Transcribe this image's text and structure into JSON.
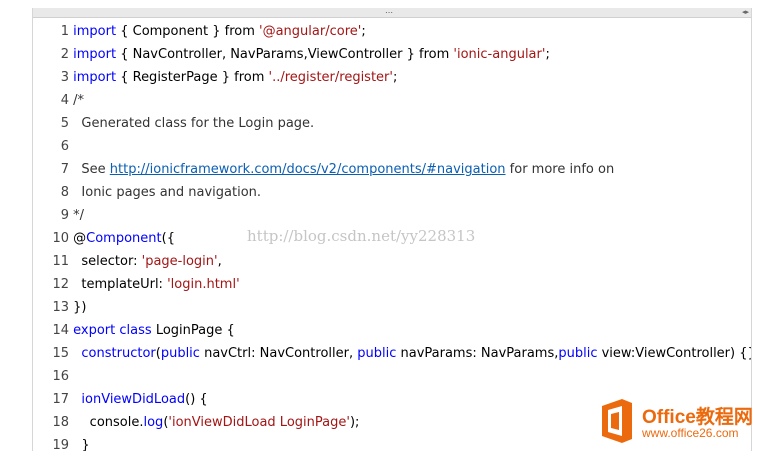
{
  "editor": {
    "grip_icon": "⋯",
    "arrows_icon": "◂▸"
  },
  "lines": [
    {
      "n": "1",
      "parts": [
        {
          "t": "import",
          "c": "kw"
        },
        {
          "t": " { Component } from ",
          "c": ""
        },
        {
          "t": "'@angular/core'",
          "c": "str"
        },
        {
          "t": ";",
          "c": ""
        }
      ]
    },
    {
      "n": "2",
      "parts": [
        {
          "t": "import",
          "c": "kw"
        },
        {
          "t": " { NavController, NavParams,ViewController } from ",
          "c": ""
        },
        {
          "t": "'ionic-angular'",
          "c": "str"
        },
        {
          "t": ";",
          "c": ""
        }
      ]
    },
    {
      "n": "3",
      "parts": [
        {
          "t": "import",
          "c": "kw"
        },
        {
          "t": " { RegisterPage } from ",
          "c": ""
        },
        {
          "t": "'../register/register'",
          "c": "str"
        },
        {
          "t": ";",
          "c": ""
        }
      ]
    },
    {
      "n": "4",
      "parts": [
        {
          "t": "/*",
          "c": "cm"
        }
      ]
    },
    {
      "n": "5",
      "parts": [
        {
          "t": "  Generated class for the Login page.",
          "c": "cm"
        }
      ]
    },
    {
      "n": "6",
      "parts": []
    },
    {
      "n": "7",
      "parts": [
        {
          "t": "  See ",
          "c": "cm"
        },
        {
          "t": "http://ionicframework.com/docs/v2/components/#navigation",
          "c": "lnk"
        },
        {
          "t": " for more info on",
          "c": "cm"
        }
      ]
    },
    {
      "n": "8",
      "parts": [
        {
          "t": "  Ionic pages and navigation.",
          "c": "cm"
        }
      ]
    },
    {
      "n": "9",
      "parts": [
        {
          "t": "*/",
          "c": "cm"
        }
      ]
    },
    {
      "n": "10",
      "parts": [
        {
          "t": "@",
          "c": ""
        },
        {
          "t": "Component",
          "c": "kw"
        },
        {
          "t": "({",
          "c": ""
        }
      ]
    },
    {
      "n": "11",
      "parts": [
        {
          "t": "  selector: ",
          "c": ""
        },
        {
          "t": "'page-login'",
          "c": "str"
        },
        {
          "t": ",",
          "c": ""
        }
      ]
    },
    {
      "n": "12",
      "parts": [
        {
          "t": "  templateUrl: ",
          "c": ""
        },
        {
          "t": "'login.html'",
          "c": "str"
        }
      ]
    },
    {
      "n": "13",
      "parts": [
        {
          "t": "})",
          "c": ""
        }
      ]
    },
    {
      "n": "14",
      "parts": [
        {
          "t": "export",
          "c": "kw"
        },
        {
          "t": " ",
          "c": ""
        },
        {
          "t": "class",
          "c": "kw"
        },
        {
          "t": " LoginPage {",
          "c": ""
        }
      ]
    },
    {
      "n": "15",
      "parts": [
        {
          "t": "  ",
          "c": ""
        },
        {
          "t": "constructor",
          "c": "kw"
        },
        {
          "t": "(",
          "c": ""
        },
        {
          "t": "public",
          "c": "kw"
        },
        {
          "t": " navCtrl: NavController, ",
          "c": ""
        },
        {
          "t": "public",
          "c": "kw"
        },
        {
          "t": " navParams: NavParams,",
          "c": ""
        },
        {
          "t": "public",
          "c": "kw"
        },
        {
          "t": " view:ViewController) {}",
          "c": ""
        }
      ]
    },
    {
      "n": "16",
      "parts": []
    },
    {
      "n": "17",
      "parts": [
        {
          "t": "  ",
          "c": ""
        },
        {
          "t": "ionViewDidLoad",
          "c": "kw"
        },
        {
          "t": "() {",
          "c": ""
        }
      ]
    },
    {
      "n": "18",
      "parts": [
        {
          "t": "    console.",
          "c": ""
        },
        {
          "t": "log",
          "c": "kw"
        },
        {
          "t": "(",
          "c": ""
        },
        {
          "t": "'ionViewDidLoad LoginPage'",
          "c": "str"
        },
        {
          "t": ");",
          "c": ""
        }
      ]
    },
    {
      "n": "19",
      "parts": [
        {
          "t": "  }",
          "c": ""
        }
      ]
    }
  ],
  "watermark": "http://blog.csdn.net/yy228313",
  "logo": {
    "name": "Office教程网",
    "url": "www.office26.com",
    "color": "#ec6a0e"
  }
}
